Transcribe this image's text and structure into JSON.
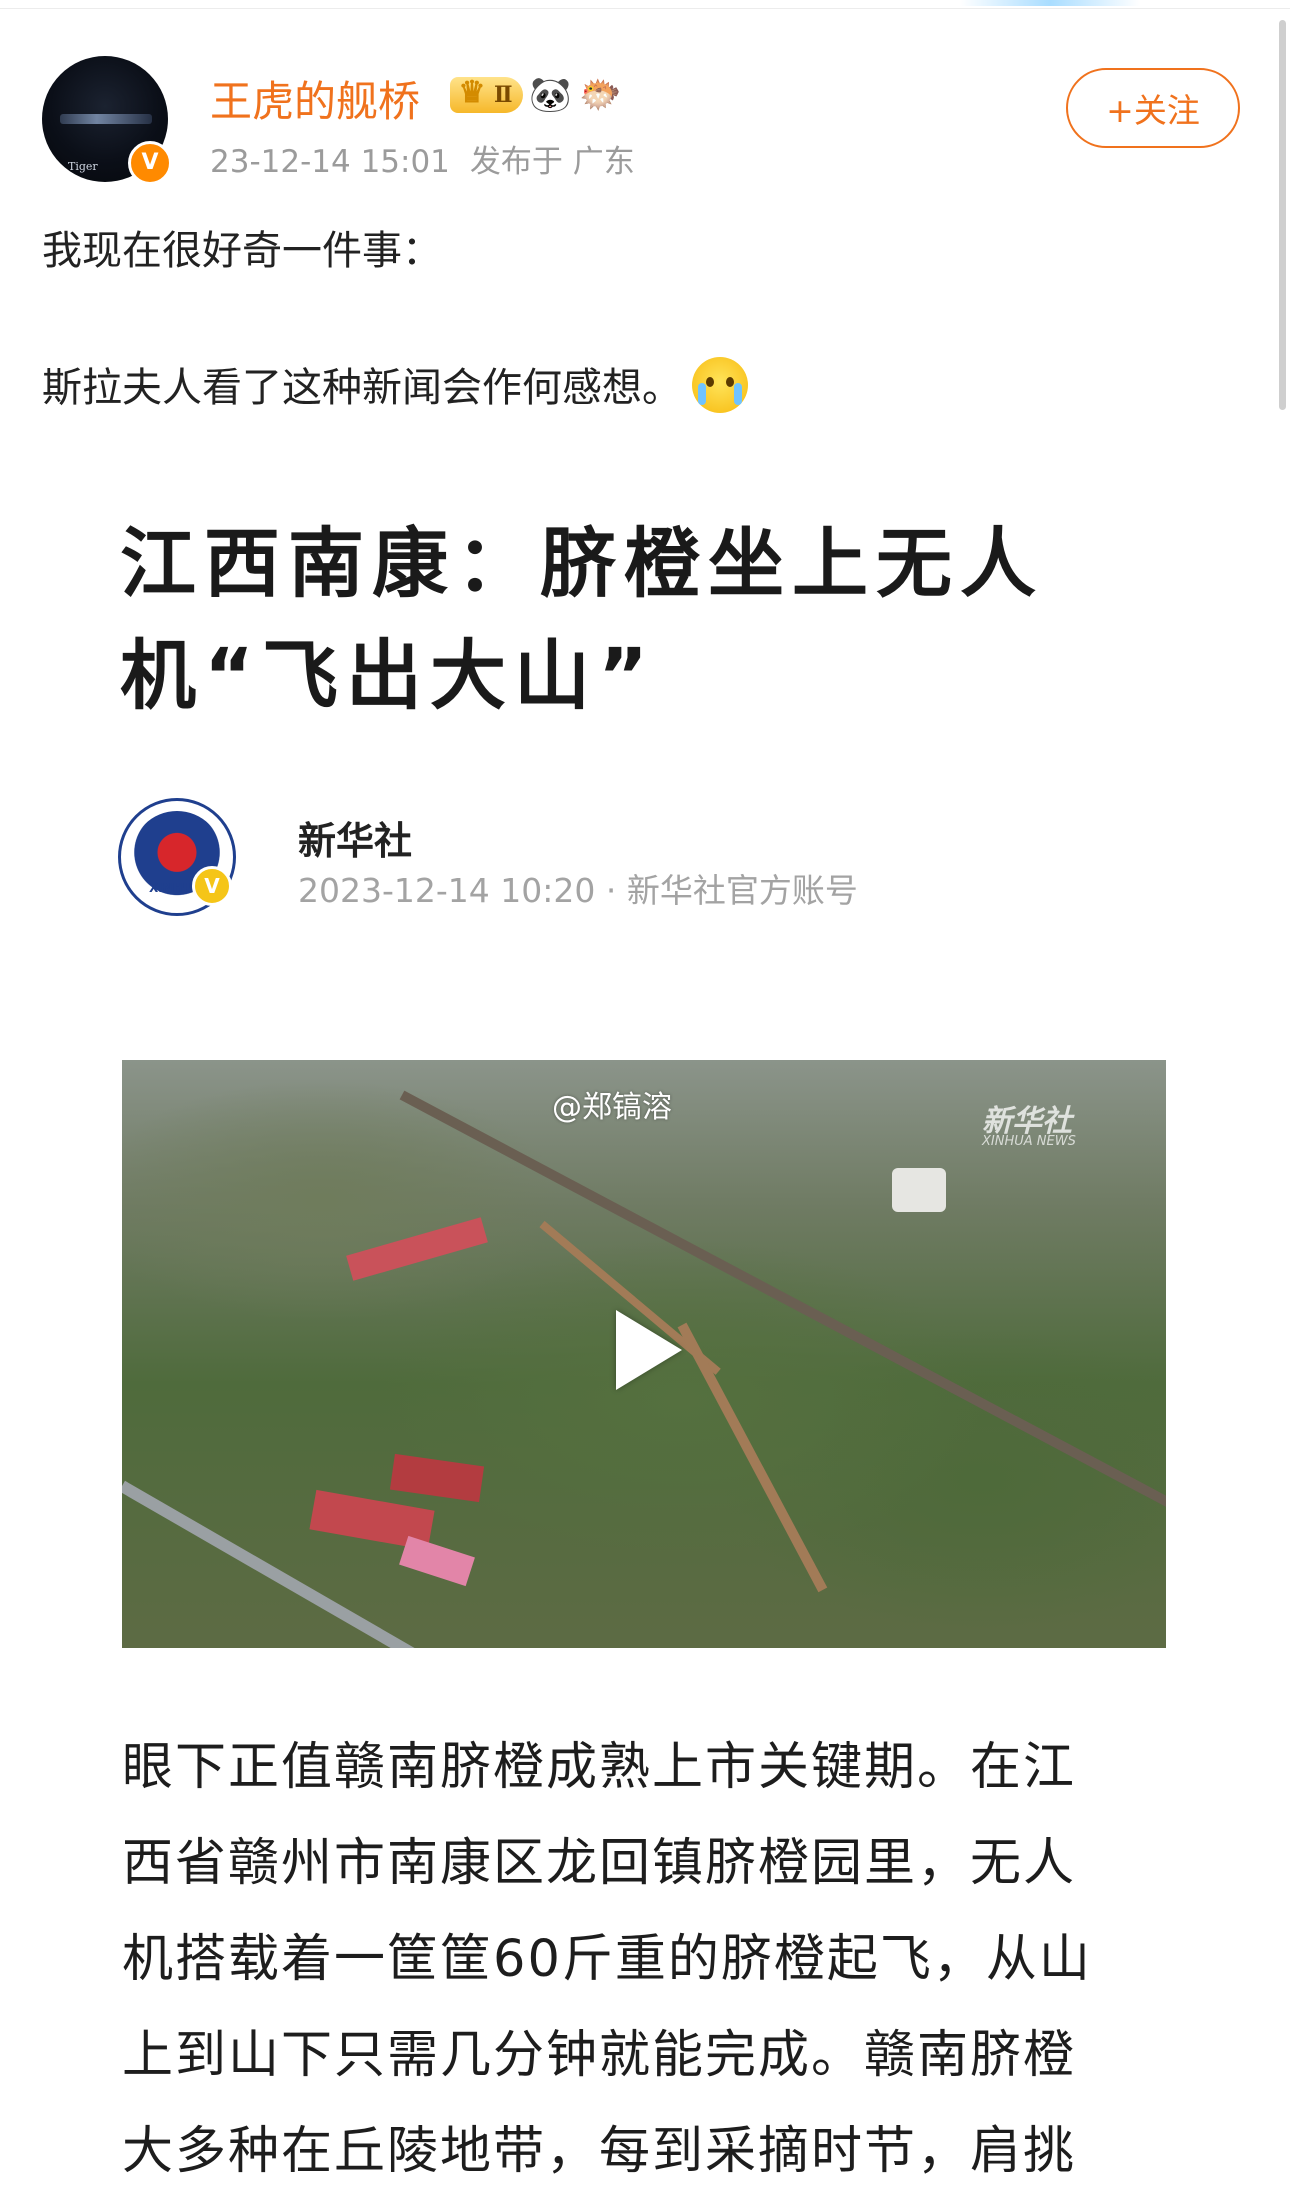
{
  "post": {
    "author": {
      "name": "王虎的舰桥",
      "avatar_icon": "avatar-image",
      "verified_icon": "verified-badge-icon",
      "badges": [
        {
          "icon": "crown-icon",
          "label": "Ⅱ"
        },
        {
          "icon": "panda-icon"
        },
        {
          "icon": "fish-icon"
        }
      ]
    },
    "timestamp": "23-12-14 15:01",
    "location": "发布于 广东",
    "follow_label": "+关注",
    "text_lines": [
      "我现在很好奇一件事：",
      "斯拉夫人看了这种新闻会作何感想。"
    ],
    "emoji": "crying-laughing-emoji"
  },
  "article": {
    "title": "江西南康：脐橙坐上无人机“飞出大山”",
    "source": {
      "name": "新华社",
      "meta": "2023-12-14 10:20 · 新华社官方账号",
      "avatar_icon": "xinhua-logo-icon",
      "avatar_label": "XINHU",
      "verified_label": "V"
    },
    "video": {
      "watermark": "@郑镐溶",
      "logo": "新华社",
      "logo_sub": "XINHUA NEWS"
    },
    "body_lines": [
      "眼下正值赣南脐橙成熟上市关键期。在江",
      "西省赣州市南康区龙回镇脐橙园里，无人",
      "机搭载着一筐筐60斤重的脐橙起飞，从山",
      "上到山下只需几分钟就能完成。赣南脐橙",
      "大多种在丘陵地带，每到采摘时节，肩挑"
    ]
  },
  "colors": {
    "accent": "#f0721d",
    "meta": "#9b9b9b",
    "text": "#222222"
  }
}
